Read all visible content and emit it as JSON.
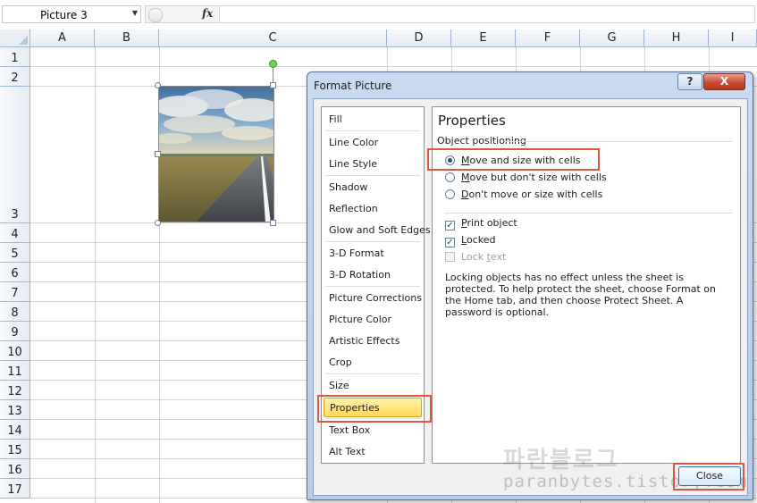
{
  "formula_bar": {
    "name_box_value": "Picture 3",
    "fx_label": "fx",
    "formula_value": ""
  },
  "sheet": {
    "columns": [
      "A",
      "B",
      "C",
      "D",
      "E",
      "F",
      "G",
      "H",
      "I"
    ],
    "rows": [
      "1",
      "2",
      "3",
      "4",
      "5",
      "6",
      "7",
      "8",
      "9",
      "10",
      "11",
      "12",
      "13",
      "14",
      "15",
      "16",
      "17"
    ]
  },
  "dialog": {
    "title": "Format Picture",
    "help_label": "?",
    "close_x_label": "X",
    "categories": [
      {
        "label": "Fill"
      },
      {
        "label": "Line Color"
      },
      {
        "label": "Line Style"
      },
      {
        "label": "Shadow"
      },
      {
        "label": "Reflection"
      },
      {
        "label": "Glow and Soft Edges"
      },
      {
        "label": "3-D Format"
      },
      {
        "label": "3-D Rotation"
      },
      {
        "label": "Picture Corrections"
      },
      {
        "label": "Picture Color"
      },
      {
        "label": "Artistic Effects"
      },
      {
        "label": "Crop"
      },
      {
        "label": "Size"
      },
      {
        "label": "Properties"
      },
      {
        "label": "Text Box"
      },
      {
        "label": "Alt Text"
      }
    ],
    "selected_category": "Properties",
    "panel": {
      "heading": "Properties",
      "group_label": "Object positioning",
      "radio_options": [
        {
          "pre": "",
          "key": "M",
          "post": "ove and size with cells",
          "checked": true
        },
        {
          "pre": "",
          "key": "M",
          "post": "ove but don't size with cells",
          "checked": false
        },
        {
          "pre": "",
          "key": "D",
          "post": "on't move or size with cells",
          "checked": false
        }
      ],
      "checkboxes": [
        {
          "pre": "",
          "key": "P",
          "post": "rint object",
          "checked": true,
          "enabled": true
        },
        {
          "pre": "",
          "key": "L",
          "post": "ocked",
          "checked": true,
          "enabled": true
        },
        {
          "pre": "Lock ",
          "key": "t",
          "post": "ext",
          "checked": false,
          "enabled": false
        }
      ],
      "note": "Locking objects has no effect unless the sheet is protected. To help protect the sheet, choose Format on the Home tab, and then choose Protect Sheet. A password is optional."
    },
    "close_button_label": "Close"
  },
  "watermark": {
    "korean_text": "파란블로그",
    "url_text": "paranbytes.tistory.com"
  },
  "colors": {
    "highlight_border": "#d9583f",
    "selected_category_fill": "#ffd95a",
    "header_fill": "#e4ebf3"
  }
}
